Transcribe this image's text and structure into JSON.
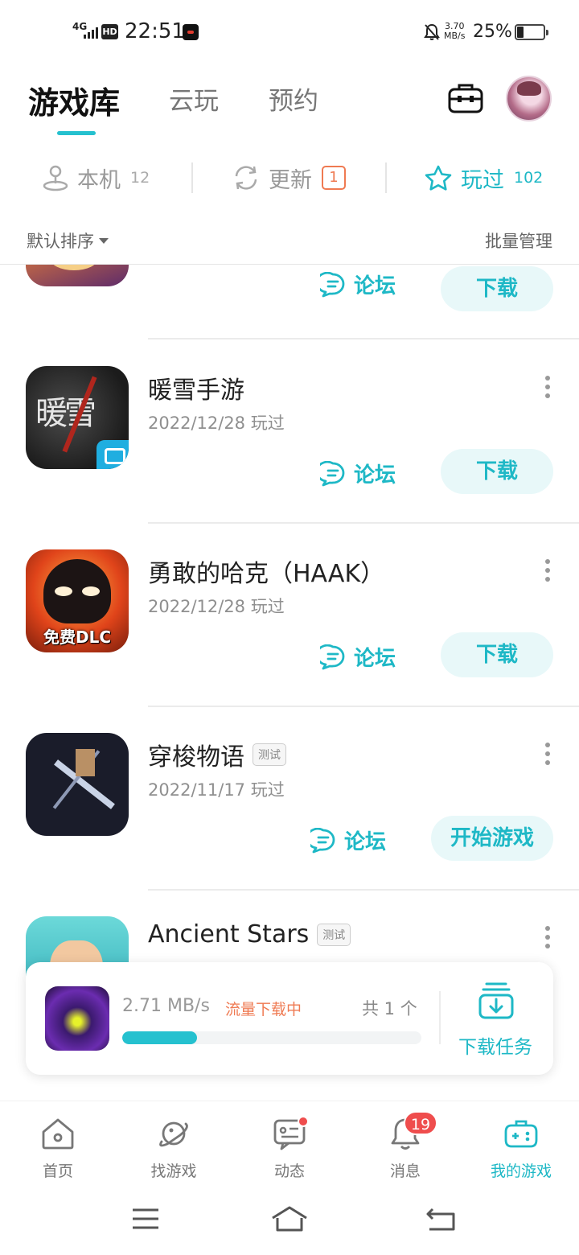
{
  "status_bar": {
    "network": "4G",
    "hd": "HD",
    "time": "22:51",
    "speed_value": "3.70",
    "speed_unit": "MB/s",
    "battery": "25%"
  },
  "header": {
    "tabs": [
      {
        "label": "游戏库",
        "active": true
      },
      {
        "label": "云玩",
        "active": false
      },
      {
        "label": "预约",
        "active": false
      }
    ]
  },
  "filters": {
    "local": {
      "label": "本机",
      "count": "12"
    },
    "update": {
      "label": "更新",
      "badge": "1"
    },
    "played": {
      "label": "玩过",
      "count": "102",
      "active": true
    }
  },
  "sort": {
    "label": "默认排序",
    "batch": "批量管理"
  },
  "games": [
    {
      "title": "",
      "date": "",
      "forum": "论坛",
      "action": "下载"
    },
    {
      "title": "暖雪手游",
      "date": "2022/12/28 玩过",
      "forum": "论坛",
      "action": "下载",
      "icon_text": "暖雪"
    },
    {
      "title": "勇敢的哈克（HAAK）",
      "date": "2022/12/28 玩过",
      "forum": "论坛",
      "action": "下载",
      "icon_text": "免费DLC"
    },
    {
      "title": "穿梭物语",
      "tag": "测试",
      "date": "2022/11/17 玩过",
      "forum": "论坛",
      "action": "开始游戏"
    },
    {
      "title": "Ancient Stars",
      "tag": "测试"
    }
  ],
  "download": {
    "speed": "2.71 MB/s",
    "status": "流量下载中",
    "total": "共 1 个",
    "progress": 0.25,
    "task_label": "下载任务"
  },
  "bottom_nav": {
    "items": [
      {
        "label": "首页",
        "icon": "home-icon"
      },
      {
        "label": "找游戏",
        "icon": "planet-icon"
      },
      {
        "label": "动态",
        "icon": "chat-icon",
        "dot": true
      },
      {
        "label": "消息",
        "icon": "bell-icon",
        "badge": "19"
      },
      {
        "label": "我的游戏",
        "icon": "gamepad-icon",
        "active": true
      }
    ]
  },
  "colors": {
    "accent": "#1eb8c6",
    "warning": "#ef7a52",
    "badge": "#ef4d4d"
  }
}
